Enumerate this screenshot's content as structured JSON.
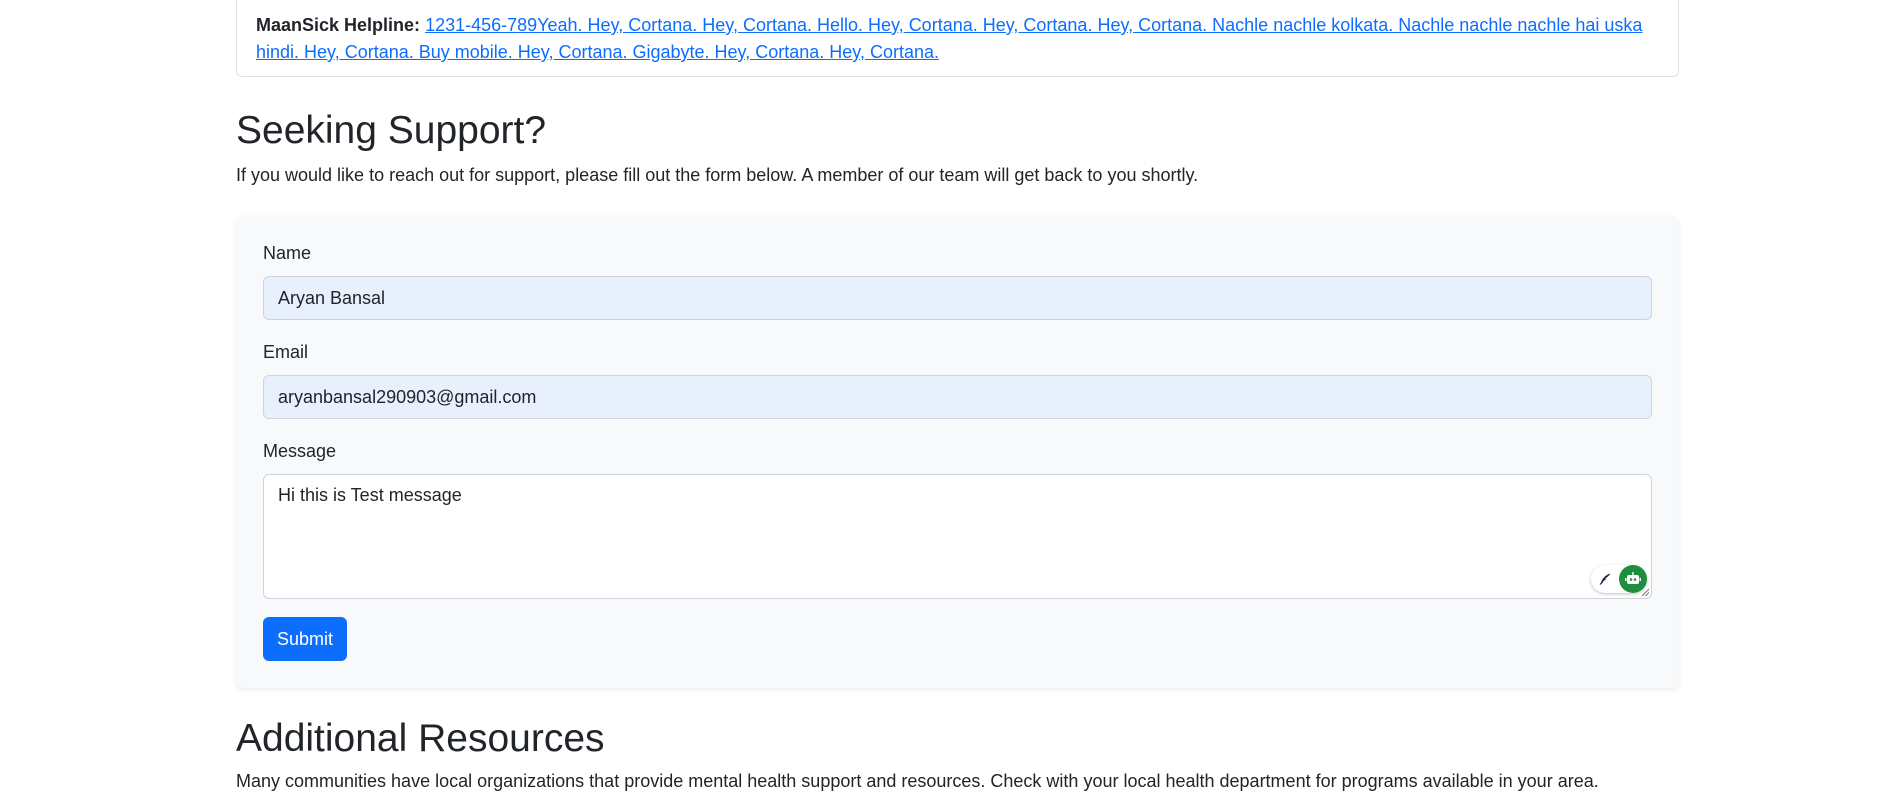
{
  "helpline": {
    "label": "MaanSick Helpline:",
    "link_text": "1231-456-789Yeah. Hey, Cortana. Hey, Cortana. Hello. Hey, Cortana. Hey, Cortana. Hey, Cortana. Nachle nachle kolkata. Nachle nachle nachle hai uska hindi. Hey, Cortana. Buy mobile. Hey, Cortana. Gigabyte. Hey, Cortana. Hey, Cortana."
  },
  "support": {
    "title": "Seeking Support?",
    "description": "If you would like to reach out for support, please fill out the form below. A member of our team will get back to you shortly."
  },
  "form": {
    "name_label": "Name",
    "name_value": "Aryan Bansal",
    "email_label": "Email",
    "email_value": "aryanbansal290903@gmail.com",
    "message_label": "Message",
    "message_value": "Hi this is Test message",
    "submit_label": "Submit"
  },
  "resources": {
    "title": "Additional Resources",
    "description": "Many communities have local organizations that provide mental health support and resources. Check with your local health department for programs available in your area."
  },
  "colors": {
    "primary": "#0d6efd",
    "autofill_bg": "#e8f0fe",
    "card_bg": "#f8f9fa",
    "text": "#212529",
    "extension_green": "#1e8e3e"
  },
  "icons": {
    "writing_assistant": "quill-pen-icon",
    "extension": "robot-icon",
    "resize": "resize-grip-icon"
  }
}
